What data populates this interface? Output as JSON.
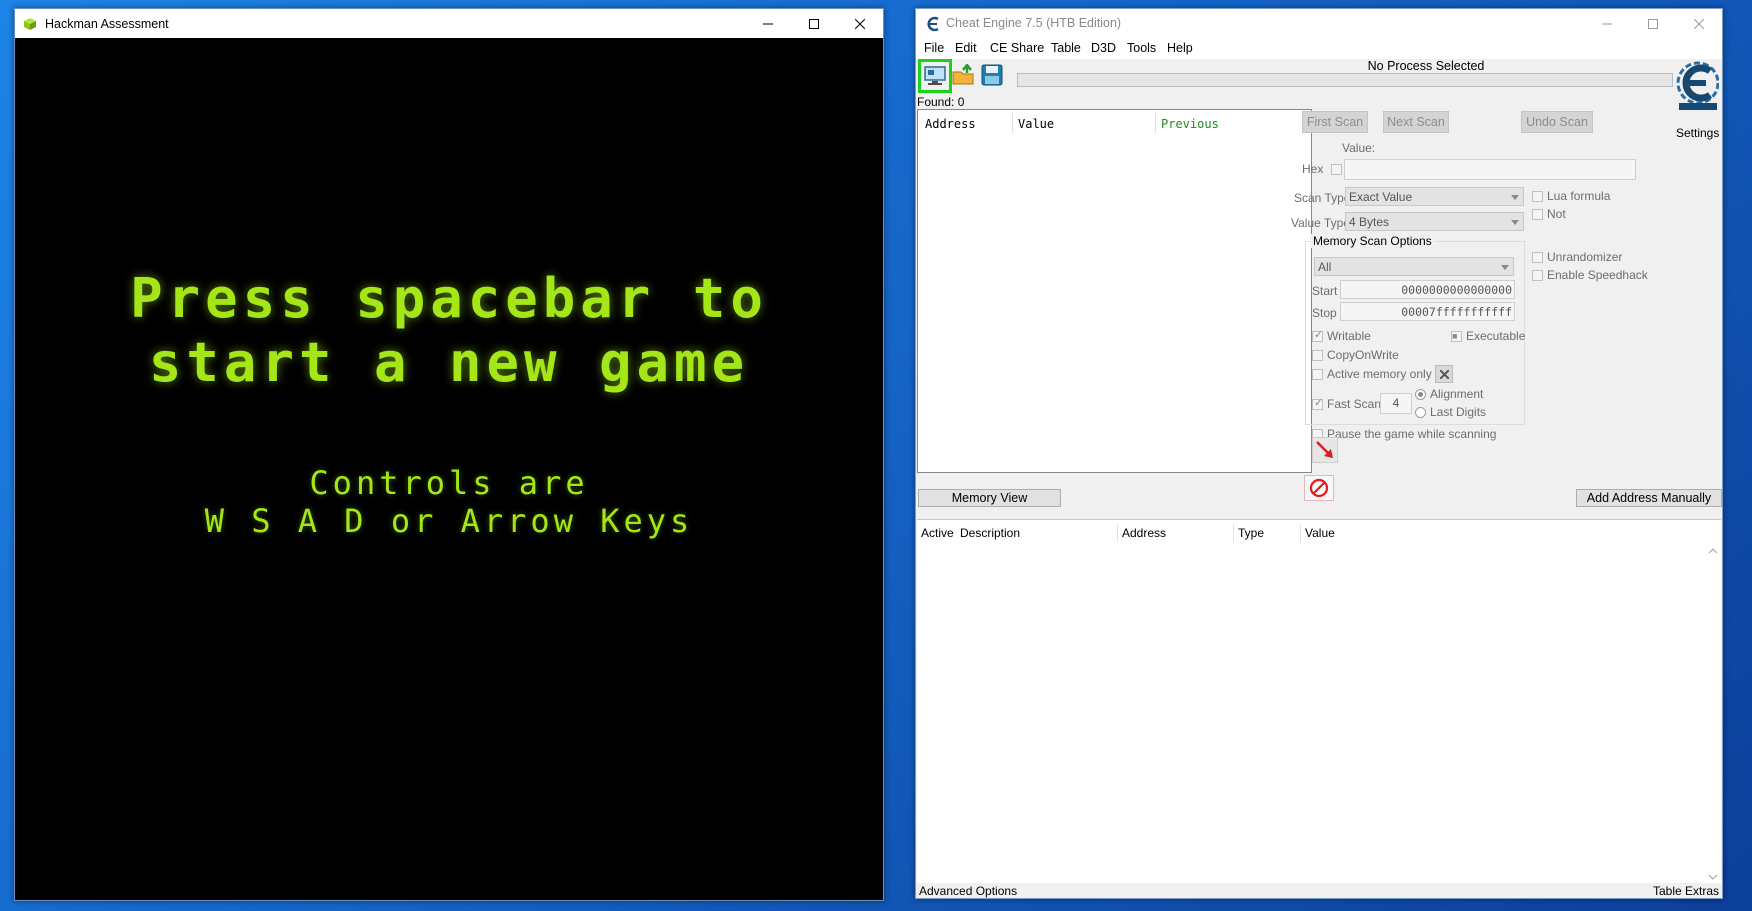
{
  "colors": {
    "desktop": "#1565c8",
    "game_text": "#a4e617",
    "selected_tool": "#19d219",
    "previous_header": "#1a8f1a",
    "stop_icon": "#e31b1b"
  },
  "game_window": {
    "title": "Hackman Assessment",
    "icon": "cube-icon",
    "line1": "Press spacebar to",
    "line2": "start a new game",
    "line3": "Controls are",
    "line4": "W S A D or Arrow Keys"
  },
  "cheat_engine": {
    "title": "Cheat Engine 7.5 (HTB Edition)",
    "menu": [
      "File",
      "Edit",
      "CE Share",
      "Table",
      "D3D",
      "Tools",
      "Help"
    ],
    "process_label": "No Process Selected",
    "found": "Found: 0",
    "settings": "Settings",
    "results_headers": {
      "address": "Address",
      "value": "Value",
      "previous": "Previous"
    },
    "buttons": {
      "first_scan": "First Scan",
      "next_scan": "Next Scan",
      "undo_scan": "Undo Scan",
      "memory_view": "Memory View",
      "add_address": "Add Address Manually"
    },
    "value_label": "Value:",
    "hex_label": "Hex",
    "scan_type_label": "Scan Type",
    "scan_type_value": "Exact Value",
    "value_type_label": "Value Type",
    "value_type_value": "4 Bytes",
    "lua_formula": "Lua formula",
    "not_label": "Not",
    "memory_scan_options": "Memory Scan Options",
    "region_value": "All",
    "start_label": "Start",
    "start_value": "0000000000000000",
    "stop_label": "Stop",
    "stop_value": "00007fffffffffff",
    "writable": "Writable",
    "executable": "Executable",
    "copy_on_write": "CopyOnWrite",
    "active_memory_only": "Active memory only",
    "fast_scan": "Fast Scan",
    "fast_scan_value": "4",
    "alignment": "Alignment",
    "last_digits": "Last Digits",
    "pause_game": "Pause the game while scanning",
    "unrandomizer": "Unrandomizer",
    "enable_speedhack": "Enable Speedhack",
    "table_headers": {
      "active": "Active",
      "description": "Description",
      "address": "Address",
      "type": "Type",
      "value": "Value"
    },
    "advanced_options": "Advanced Options",
    "table_extras": "Table Extras"
  }
}
